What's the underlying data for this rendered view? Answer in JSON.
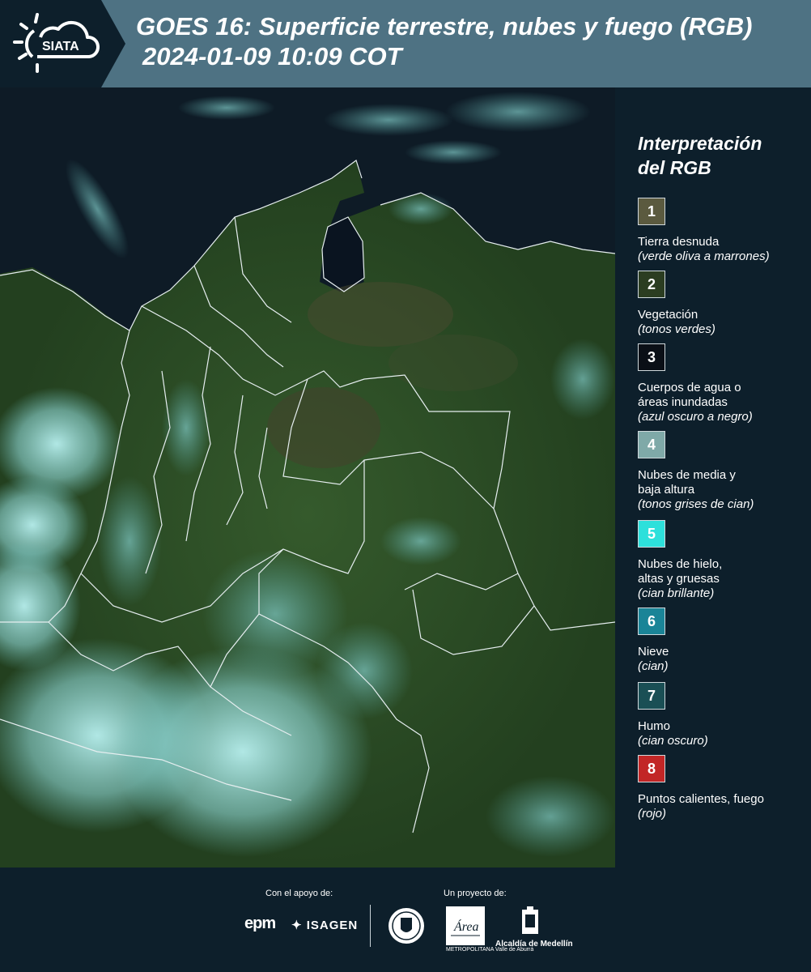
{
  "header": {
    "logo_text": "SIATA",
    "title": "GOES 16: Superficie terrestre, nubes y fuego (RGB)",
    "date": "2024-01-09 10:09 COT"
  },
  "legend": {
    "title": "Interpretación del RGB",
    "items": [
      {
        "number": "1",
        "label": "Tierra desnuda",
        "desc": "(verde oliva a marrones)",
        "color": "#5b5a3f"
      },
      {
        "number": "2",
        "label": "Vegetación",
        "desc": "(tonos verdes)",
        "color": "#2b3d21"
      },
      {
        "number": "3",
        "label": "Cuerpos de agua o áreas inundadas",
        "desc": "(azul oscuro a negro)",
        "color": "#0a0f16"
      },
      {
        "number": "4",
        "label": "Nubes de media y baja altura",
        "desc": "(tonos grises de cian)",
        "color": "#7fa9a8"
      },
      {
        "number": "5",
        "label": "Nubes de hielo, altas y gruesas",
        "desc": "(cian brillante)",
        "color": "#2de0db"
      },
      {
        "number": "6",
        "label": "Nieve",
        "desc": "(cian)",
        "color": "#1a8497"
      },
      {
        "number": "7",
        "label": "Humo",
        "desc": "(cian oscuro)",
        "color": "#1a4f55"
      },
      {
        "number": "8",
        "label": "Puntos calientes, fuego",
        "desc": "(rojo)",
        "color": "#c22626"
      }
    ]
  },
  "footer": {
    "support_caption": "Con el apoyo de:",
    "project_caption": "Un proyecto de:",
    "epm": "epm",
    "isagen": "ISAGEN",
    "area_text": "METROPOLITANA Valle de Aburrá",
    "alcaldia": "Alcaldía de Medellín",
    "area_word": "Área"
  }
}
